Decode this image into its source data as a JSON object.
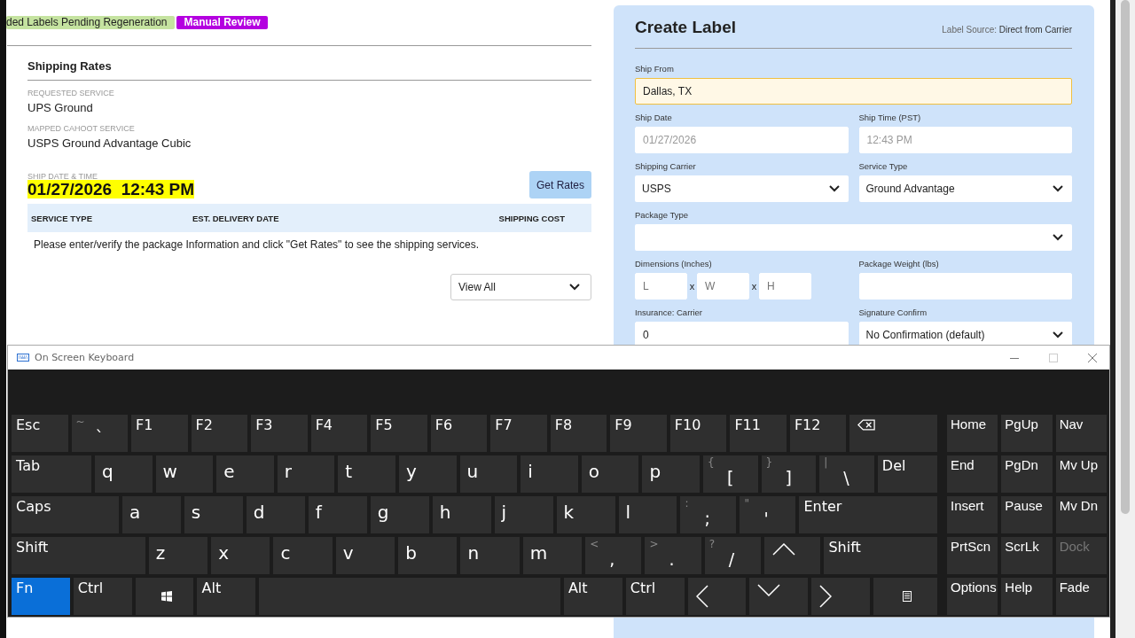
{
  "tags": [
    {
      "label": "ded Labels Pending Regeneration",
      "color": "#c5e3a0"
    },
    {
      "label": "Manual Review",
      "color": "#b400e0"
    }
  ],
  "shipping_rates": {
    "title": "Shipping Rates",
    "fields": [
      {
        "label": "REQUESTED SERVICE",
        "value": "UPS Ground"
      },
      {
        "label": "MAPPED CAHOOT SERVICE",
        "value": "USPS Ground Advantage Cubic"
      }
    ],
    "ship_datetime": {
      "label": "SHIP DATE & TIME",
      "value": "01/27/2026  12:43 PM"
    },
    "get_rates_button": "Get Rates",
    "table": {
      "columns": [
        "SERVICE TYPE",
        "EST. DELIVERY DATE",
        "SHIPPING COST"
      ],
      "message": "Please enter/verify the package Information and click \"Get Rates\" to see the shipping services."
    },
    "filter": {
      "value": "View All"
    }
  },
  "create_label": {
    "title": "Create Label",
    "source_label": "Label Source:",
    "source_value": "Direct from Carrier",
    "rows": [
      [
        {
          "label": "Ship From",
          "kind": "input",
          "value": "Dallas, TX",
          "highlighted": true,
          "disabled": false
        }
      ],
      [
        {
          "label": "Ship Date",
          "kind": "input",
          "value": "01/27/2026",
          "highlighted": false,
          "disabled": true
        },
        {
          "label": "Ship Time (PST)",
          "kind": "input",
          "value": "12:43 PM",
          "highlighted": false,
          "disabled": true
        }
      ],
      [
        {
          "label": "Shipping Carrier",
          "kind": "select",
          "value": "USPS"
        },
        {
          "label": "Service Type",
          "kind": "select",
          "value": "Ground Advantage"
        }
      ],
      [
        {
          "label": "Package Type",
          "kind": "select"
        }
      ],
      [
        {
          "label": "Dimensions (Inches)",
          "kind": "dimensions",
          "parts": [
            {
              "placeholder": "L"
            },
            {
              "placeholder": "W"
            },
            {
              "placeholder": "H"
            }
          ],
          "separators": [
            "x",
            "x"
          ]
        },
        {
          "label": "Package Weight (lbs)",
          "kind": "input",
          "highlighted": false
        }
      ],
      [
        {
          "label": "Insurance: Carrier",
          "kind": "input",
          "value": "0",
          "highlighted": false,
          "disabled": false
        },
        {
          "label": "Signature Confirm",
          "kind": "select",
          "value": "No Confirmation (default)"
        }
      ]
    ]
  },
  "keyboard": {
    "title": "On Screen Keyboard",
    "function_row": [
      {
        "kind": "text",
        "label": "Esc",
        "on": false
      },
      {
        "kind": "dual",
        "shift": "~",
        "label": "`",
        "on": false
      },
      {
        "kind": "text",
        "label": "F1",
        "on": false
      },
      {
        "kind": "text",
        "label": "F2",
        "on": false
      },
      {
        "kind": "text",
        "label": "F3",
        "on": false
      },
      {
        "kind": "text",
        "label": "F4",
        "on": false
      },
      {
        "kind": "text",
        "label": "F5",
        "on": false
      },
      {
        "kind": "text",
        "label": "F6",
        "on": false
      },
      {
        "kind": "text",
        "label": "F7",
        "on": false
      },
      {
        "kind": "text",
        "label": "F8",
        "on": false
      },
      {
        "kind": "text",
        "label": "F9",
        "on": false
      },
      {
        "kind": "text",
        "label": "F10",
        "on": false
      },
      {
        "kind": "text",
        "label": "F11",
        "on": false
      },
      {
        "kind": "text",
        "label": "F12",
        "on": false
      },
      {
        "kind": "backspace",
        "on": false
      }
    ],
    "top_row": [
      {
        "kind": "text",
        "label": "Tab",
        "on": false
      },
      {
        "kind": "letter",
        "label": "q",
        "on": false
      },
      {
        "kind": "letter",
        "label": "w",
        "on": false
      },
      {
        "kind": "letter",
        "label": "e",
        "on": false
      },
      {
        "kind": "letter",
        "label": "r",
        "on": false
      },
      {
        "kind": "letter",
        "label": "t",
        "on": false
      },
      {
        "kind": "letter",
        "label": "y",
        "on": false
      },
      {
        "kind": "letter",
        "label": "u",
        "on": false
      },
      {
        "kind": "letter",
        "label": "i",
        "on": false
      },
      {
        "kind": "letter",
        "label": "o",
        "on": false
      },
      {
        "kind": "letter",
        "label": "p",
        "on": false
      },
      {
        "kind": "dual",
        "shift": "{",
        "label": "[",
        "on": false
      },
      {
        "kind": "dual",
        "shift": "}",
        "label": "]",
        "on": false
      },
      {
        "kind": "dual",
        "shift": "|",
        "label": "\\",
        "on": false
      },
      {
        "kind": "text",
        "label": "Del",
        "on": false
      }
    ],
    "home_row": [
      {
        "kind": "text",
        "label": "Caps",
        "on": false
      },
      {
        "kind": "letter",
        "label": "a",
        "on": false
      },
      {
        "kind": "letter",
        "label": "s",
        "on": false
      },
      {
        "kind": "letter",
        "label": "d",
        "on": false
      },
      {
        "kind": "letter",
        "label": "f",
        "on": false
      },
      {
        "kind": "letter",
        "label": "g",
        "on": false
      },
      {
        "kind": "letter",
        "label": "h",
        "on": false
      },
      {
        "kind": "letter",
        "label": "j",
        "on": false
      },
      {
        "kind": "letter",
        "label": "k",
        "on": false
      },
      {
        "kind": "letter",
        "label": "l",
        "on": false
      },
      {
        "kind": "dual",
        "shift": ":",
        "label": ";",
        "on": false
      },
      {
        "kind": "dual",
        "shift": "\"",
        "label": "'",
        "on": false
      },
      {
        "kind": "text",
        "label": "Enter",
        "on": false
      }
    ],
    "bottom_row": [
      {
        "kind": "text",
        "label": "Shift",
        "on": false
      },
      {
        "kind": "letter",
        "label": "z",
        "on": false
      },
      {
        "kind": "letter",
        "label": "x",
        "on": false
      },
      {
        "kind": "letter",
        "label": "c",
        "on": false
      },
      {
        "kind": "letter",
        "label": "v",
        "on": false
      },
      {
        "kind": "letter",
        "label": "b",
        "on": false
      },
      {
        "kind": "letter",
        "label": "n",
        "on": false
      },
      {
        "kind": "letter",
        "label": "m",
        "on": false
      },
      {
        "kind": "dual",
        "shift": "<",
        "label": ",",
        "on": false
      },
      {
        "kind": "dual",
        "shift": ">",
        "label": ".",
        "on": false
      },
      {
        "kind": "dual",
        "shift": "?",
        "label": "/",
        "on": false
      },
      {
        "kind": "up",
        "on": false
      },
      {
        "kind": "text",
        "label": "Shift",
        "on": false
      }
    ],
    "modifier_row": [
      {
        "kind": "text",
        "label": "Fn",
        "on": true
      },
      {
        "kind": "text",
        "label": "Ctrl",
        "on": false
      },
      {
        "kind": "windows",
        "on": false
      },
      {
        "kind": "text",
        "label": "Alt",
        "on": false
      },
      {
        "kind": "space",
        "on": false
      },
      {
        "kind": "text",
        "label": "Alt",
        "on": false
      },
      {
        "kind": "text",
        "label": "Ctrl",
        "on": false
      },
      {
        "kind": "left",
        "on": false
      },
      {
        "kind": "down",
        "on": false
      },
      {
        "kind": "right",
        "on": false
      },
      {
        "kind": "menu",
        "on": false
      }
    ],
    "nav": [
      [
        {
          "label": "Home",
          "disabled": false
        },
        {
          "label": "PgUp",
          "disabled": false
        },
        {
          "label": "Nav",
          "disabled": false
        }
      ],
      [
        {
          "label": "End",
          "disabled": false
        },
        {
          "label": "PgDn",
          "disabled": false
        },
        {
          "label": "Mv Up",
          "disabled": false
        }
      ],
      [
        {
          "label": "Insert",
          "disabled": false
        },
        {
          "label": "Pause",
          "disabled": false
        },
        {
          "label": "Mv Dn",
          "disabled": false
        }
      ],
      [
        {
          "label": "PrtScn",
          "disabled": false
        },
        {
          "label": "ScrLk",
          "disabled": false
        },
        {
          "label": "Dock",
          "disabled": true
        }
      ],
      [
        {
          "label": "Options",
          "disabled": false
        },
        {
          "label": "Help",
          "disabled": false
        },
        {
          "label": "Fade",
          "disabled": false
        }
      ]
    ]
  }
}
